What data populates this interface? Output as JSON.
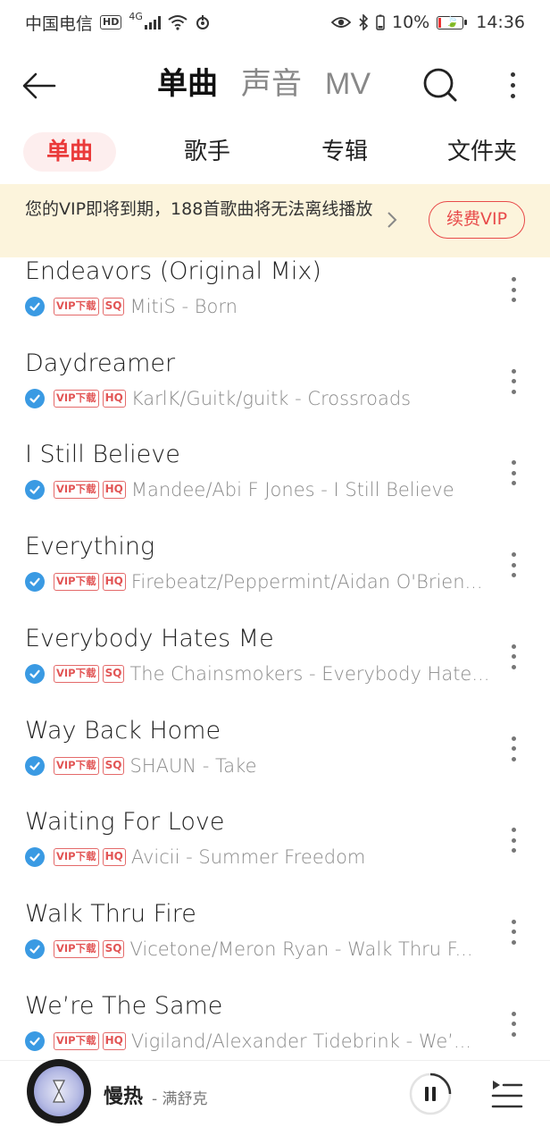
{
  "status_bar": {
    "carrier": "中国电信",
    "hd_badge": "HD",
    "network": "4G",
    "battery": "10%",
    "time": "14:36"
  },
  "nav": {
    "tabs": [
      {
        "label": "单曲",
        "active": true
      },
      {
        "label": "声音",
        "active": false
      },
      {
        "label": "MV",
        "active": false
      }
    ],
    "back_icon": "arrow-left-icon",
    "search_icon": "search-icon",
    "more_icon": "more-vertical-icon",
    "accent_color": "#f1434d"
  },
  "sub_tabs": [
    {
      "label": "单曲",
      "active": true
    },
    {
      "label": "歌手",
      "active": false
    },
    {
      "label": "专辑",
      "active": false
    },
    {
      "label": "文件夹",
      "active": false
    }
  ],
  "vip_banner": {
    "message": "您的VIP即将到期，188首歌曲将无法离线播放",
    "renew_label": "续费VIP",
    "background": "#fcf4dc"
  },
  "tags": {
    "vip_download": "VIP下载",
    "sq": "SQ",
    "hq": "HQ"
  },
  "songs": [
    {
      "title": "Endeavors (Original Mix)",
      "quality": "SQ",
      "artist_album": "MitiS - Born"
    },
    {
      "title": "Daydreamer",
      "quality": "HQ",
      "artist_album": "KarlK/Guitk/guitk - Crossroads"
    },
    {
      "title": "I Still Believe",
      "quality": "HQ",
      "artist_album": "Mandee/Abi F Jones - I Still Believe"
    },
    {
      "title": "Everything",
      "quality": "HQ",
      "artist_album": "Firebeatz/Peppermint/Aidan O'Brien..."
    },
    {
      "title": "Everybody Hates Me",
      "quality": "SQ",
      "artist_album": "The Chainsmokers - Everybody Hate..."
    },
    {
      "title": "Way Back Home",
      "quality": "SQ",
      "artist_album": "SHAUN - Take"
    },
    {
      "title": "Waiting For Love",
      "quality": "HQ",
      "artist_album": "Avicii - Summer Freedom"
    },
    {
      "title": "Walk Thru Fire",
      "quality": "SQ",
      "artist_album": "Vicetone/Meron Ryan - Walk Thru F..."
    },
    {
      "title": "We’re The Same",
      "quality": "HQ",
      "artist_album": "Vigiland/Alexander Tidebrink - We’..."
    }
  ],
  "player": {
    "title": "慢热",
    "artist": "- 满舒克",
    "state": "playing",
    "play_icon": "pause-icon",
    "playlist_icon": "playlist-icon"
  }
}
